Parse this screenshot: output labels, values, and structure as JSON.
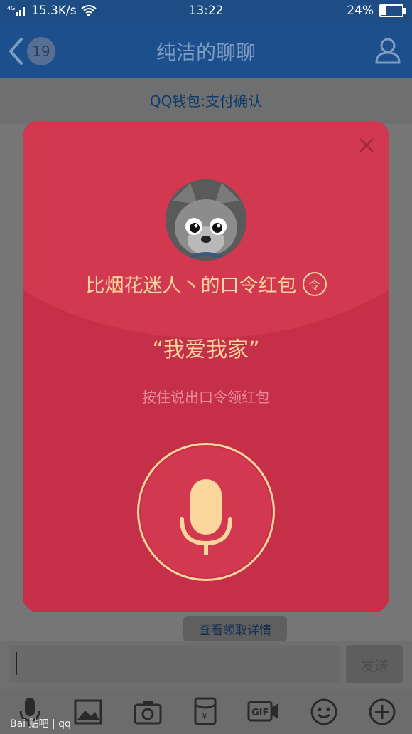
{
  "status": {
    "network": "4G",
    "speed": "15.3K/s",
    "time": "13:22",
    "battery": "24%",
    "battery_level": 0.24
  },
  "header": {
    "unread_count": "19",
    "title": "纯洁的聊聊"
  },
  "system_message": "QQ钱包:支付确认",
  "red_packet": {
    "sender_line": "比烟花迷人丶的口令红包",
    "type_badge": "令",
    "password": "“我爱我家”",
    "hint": "按住说出口令领红包"
  },
  "chat": {
    "view_details": "查看领取详情",
    "send_button": "发送"
  },
  "toolbar_icons": [
    "microphone-icon",
    "image-icon",
    "camera-icon",
    "red-packet-icon",
    "gif-icon",
    "emoji-icon",
    "plus-icon"
  ],
  "toolbar_gif_label": "GIF",
  "watermark": "Bai 贴吧 | qq",
  "colors": {
    "header": "#1d4f8c",
    "modal_red": "#c52f47",
    "accent_gold": "#fbd69d"
  }
}
